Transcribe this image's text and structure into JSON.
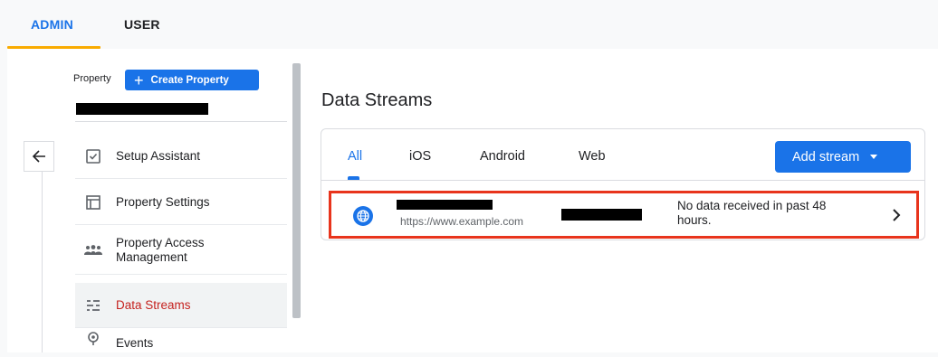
{
  "top_tabs": {
    "admin": "ADMIN",
    "user": "USER"
  },
  "property": {
    "label": "Property",
    "create_button": "Create Property"
  },
  "nav": {
    "items": [
      {
        "label": "Setup Assistant",
        "icon": "checklist-icon"
      },
      {
        "label": "Property Settings",
        "icon": "layout-icon"
      },
      {
        "label": "Property Access Management",
        "icon": "people-icon"
      },
      {
        "label": "Data Streams",
        "icon": "streams-icon",
        "active": true
      },
      {
        "label": "Events",
        "icon": "events-icon"
      }
    ]
  },
  "main": {
    "title": "Data Streams",
    "tabs": [
      "All",
      "iOS",
      "Android",
      "Web"
    ],
    "active_tab": "All",
    "add_button": "Add stream",
    "stream": {
      "url": "https://www.example.com",
      "status": "No data received in past 48 hours."
    }
  },
  "colors": {
    "accent": "#1a73e8",
    "active_nav": "#c5221f",
    "highlight": "#e8341c",
    "tab_underline": "#f9ab00"
  }
}
